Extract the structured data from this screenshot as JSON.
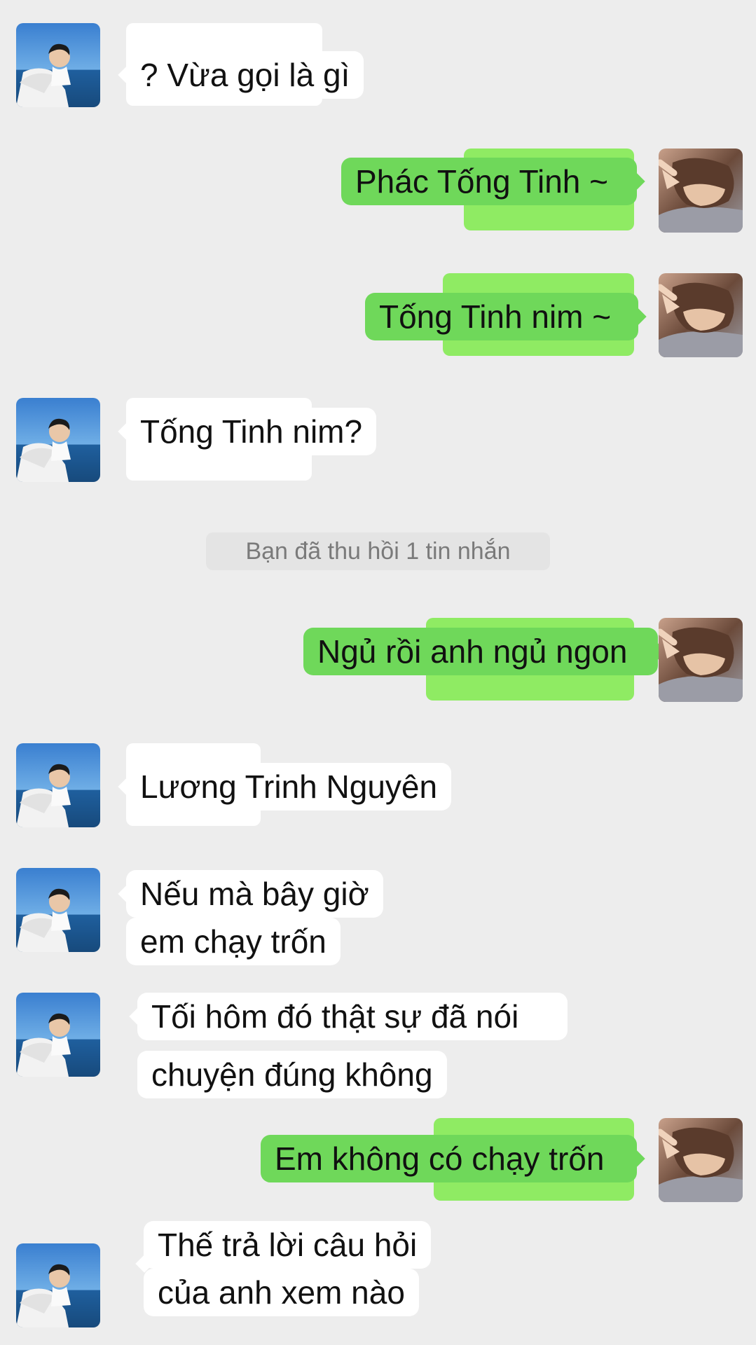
{
  "chat": {
    "messages": [
      {
        "side": "in",
        "lines": [
          "? Vừa gọi là gì"
        ]
      },
      {
        "side": "out",
        "lines": [
          "Phác Tống Tinh ~"
        ]
      },
      {
        "side": "out",
        "lines": [
          "Tống Tinh nim ~"
        ]
      },
      {
        "side": "in",
        "lines": [
          "Tống Tinh nim?"
        ]
      },
      {
        "side": "system",
        "lines": [
          "Bạn đã thu hồi 1 tin nhắn"
        ]
      },
      {
        "side": "out",
        "lines": [
          "Ngủ rồi anh ngủ ngon"
        ]
      },
      {
        "side": "in",
        "lines": [
          "Lương Trinh Nguyên"
        ]
      },
      {
        "side": "in",
        "lines": [
          "Nếu mà bây giờ",
          "em chạy trốn"
        ]
      },
      {
        "side": "in",
        "lines": [
          "Tối hôm đó thật sự đã nói",
          "chuyện đúng không"
        ]
      },
      {
        "side": "out",
        "lines": [
          "Em không có chạy trốn"
        ]
      },
      {
        "side": "in",
        "lines": [
          "Thế trả lời câu hỏi",
          "của anh xem nào"
        ]
      }
    ]
  },
  "colors": {
    "background": "#ededed",
    "incoming_bubble": "#ffffff",
    "outgoing_bubble": "#6fd85a",
    "system_text": "#7a7a7a"
  }
}
